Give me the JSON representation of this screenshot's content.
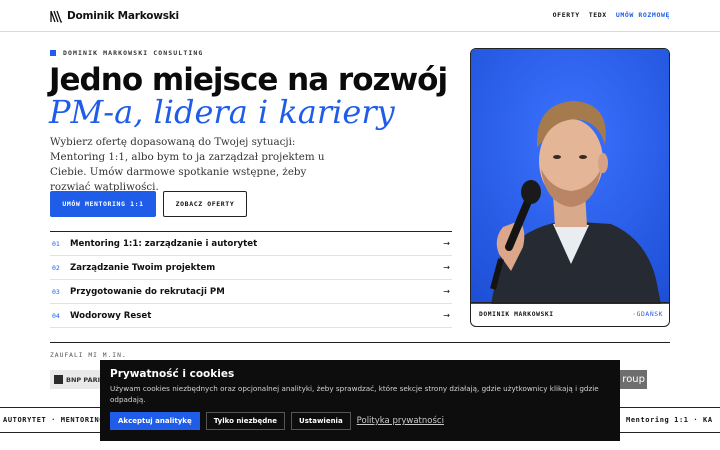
{
  "header": {
    "logo_text": "Dominik Markowski",
    "nav": [
      "OFERTY",
      "TEDX",
      "UMÓW ROZMOWĘ"
    ],
    "accent_color": "#1f5de8"
  },
  "hero": {
    "eyebrow": "DOMINIK MARKOWSKI CONSULTING",
    "title_line1": "Jedno miejsce na rozwój",
    "title_line2": "PM-a, lidera i kariery",
    "lead": "Wybierz ofertę dopasowaną do Twojej sytuacji: Mentoring 1:1, albo bym to ja zarządzał projektem u Ciebie. Umów darmowe spotkanie wstępne, żeby rozwiać wątpliwości.",
    "primary_button": "UMÓW MENTORING 1:1",
    "secondary_button": "ZOBACZ OFERTY"
  },
  "offers": [
    {
      "num": "01",
      "label": "Mentoring 1:1: zarządzanie i autorytet",
      "arrow": "→"
    },
    {
      "num": "02",
      "label": "Zarządzanie Twoim projektem",
      "arrow": "→"
    },
    {
      "num": "03",
      "label": "Przygotowanie do rekrutacji PM",
      "arrow": "→"
    },
    {
      "num": "04",
      "label": "Wodorowy Reset",
      "arrow": "→"
    }
  ],
  "photo_card": {
    "name": "DOMINIK MARKOWSKI",
    "city": "·GDAŃSK"
  },
  "trusted": {
    "label": "ZAUFALI MI M.IN.",
    "logos": [
      "BNP PARI",
      "roup"
    ]
  },
  "ticker": {
    "left": "AUTORYTET  ·  MENTORING",
    "right": "Mentoring 1:1  ·  KA"
  },
  "cookie": {
    "title": "Prywatność i cookies",
    "text": "Używam cookies niezbędnych oraz opcjonalnej analityki, żeby sprawdzać, które sekcje strony działają, gdzie użytkownicy klikają i gdzie odpadają.",
    "accept": "Akceptuj analitykę",
    "necessary": "Tylko niezbędne",
    "settings": "Ustawienia",
    "policy": "Polityka prywatności"
  }
}
